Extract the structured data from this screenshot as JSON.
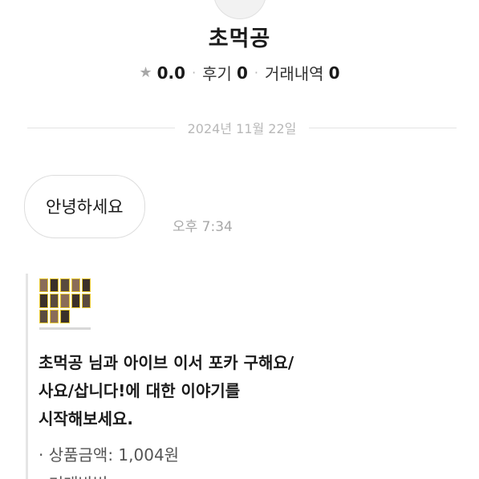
{
  "profile": {
    "name": "초먹공",
    "rating_icon": "star-icon",
    "rating": "0.0",
    "reviews_label": "후기",
    "reviews_count": "0",
    "trades_label": "거래내역",
    "trades_count": "0"
  },
  "chat": {
    "date": "2024년 11월 22일",
    "messages": [
      {
        "text": "안녕하세요",
        "time": "오후 7:34"
      }
    ]
  },
  "system_card": {
    "thumbnail_icon": "product-photo-thumbnail",
    "line1": "초먹공 님과 아이브 이서 포카 구해요/",
    "line2": "사요/삽니다!에 대한 이야기를",
    "line3": "시작해보세요.",
    "price": "· 상품금액: 1,004원",
    "trade_method_partial": "· 거래방법:"
  }
}
